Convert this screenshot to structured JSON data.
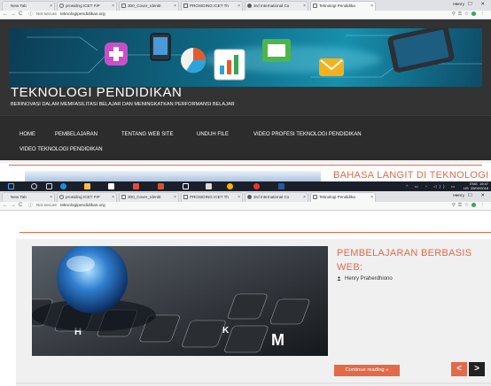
{
  "browser": {
    "tabs": [
      {
        "label": "New Tab",
        "active": false
      },
      {
        "label": "prosiding ICET FIP",
        "active": false
      },
      {
        "label": "300_Cover_Identit",
        "active": false
      },
      {
        "label": "PROSIDING ICET Th",
        "active": false
      },
      {
        "label": "3rd International Co",
        "active": false
      },
      {
        "label": "Teknologi Pendidika",
        "active": true
      }
    ],
    "profile": "Henry",
    "window_controls": "— ☐ ✕",
    "security_label": "Not secure",
    "url": "teknologipendidikan.org",
    "tabs_2": [
      {
        "label": "New Tab",
        "active": false
      },
      {
        "label": "prosiding ICET FIP",
        "active": false
      },
      {
        "label": "300_Cover_Identit",
        "active": false
      },
      {
        "label": "PROSIDING ICET Th",
        "active": false
      },
      {
        "label": "3rd International Co",
        "active": false
      },
      {
        "label": "Teknologi Pendidika",
        "active": true
      }
    ]
  },
  "site": {
    "title": "TEKNOLOGI PENDIDIKAN",
    "tagline": "BERINOVASI DALAM MEMFASILITASI BELAJAR DAN MENINGKATKAN PERFORMANSI BELAJAR",
    "menu": [
      "HOME",
      "PEMBELAJARAN",
      "TENTANG WEB SITE",
      "UNDUH FILE",
      "VIDEO PROFESI TEKNOLOGI PENDIDIKAN",
      "VIDEO TEKNOLOGI PENDIDIKAN"
    ],
    "colors": {
      "accent": "#e26a49",
      "header_bg": "#333333",
      "menu_bg": "#2c2c2c"
    }
  },
  "posts": {
    "first_title": "BAHASA LANGIT DI TEKNOLOGI PENDIDIKAN",
    "second_title": "PEMBELAJARAN BERBASIS WEB:",
    "second_author": "Henry Praherdhiono",
    "continue_label": "Continue reading »",
    "prev_label": "<",
    "next_label": ">"
  },
  "taskbar": {
    "time": "19:47",
    "date": "25/02/2018",
    "lang_line1": "ENG",
    "lang_line2": "US"
  }
}
